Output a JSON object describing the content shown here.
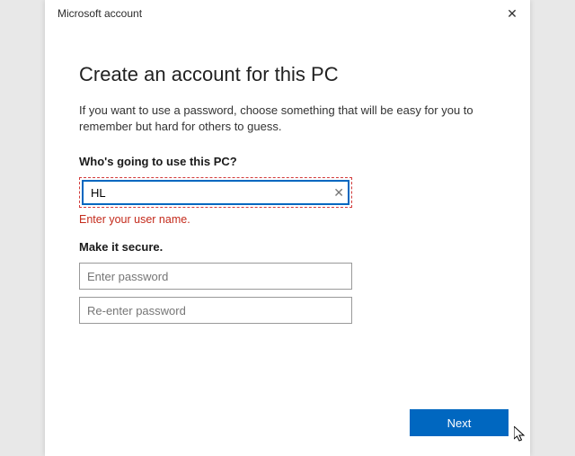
{
  "window": {
    "title": "Microsoft account"
  },
  "heading": "Create an account for this PC",
  "description": "If you want to use a password, choose something that will be easy for you to remember but hard for others to guess.",
  "username": {
    "label": "Who's going to use this PC?",
    "value": "HL",
    "error": "Enter your user name."
  },
  "password": {
    "label": "Make it secure.",
    "placeholder1": "Enter password",
    "placeholder2": "Re-enter password"
  },
  "next_label": "Next"
}
